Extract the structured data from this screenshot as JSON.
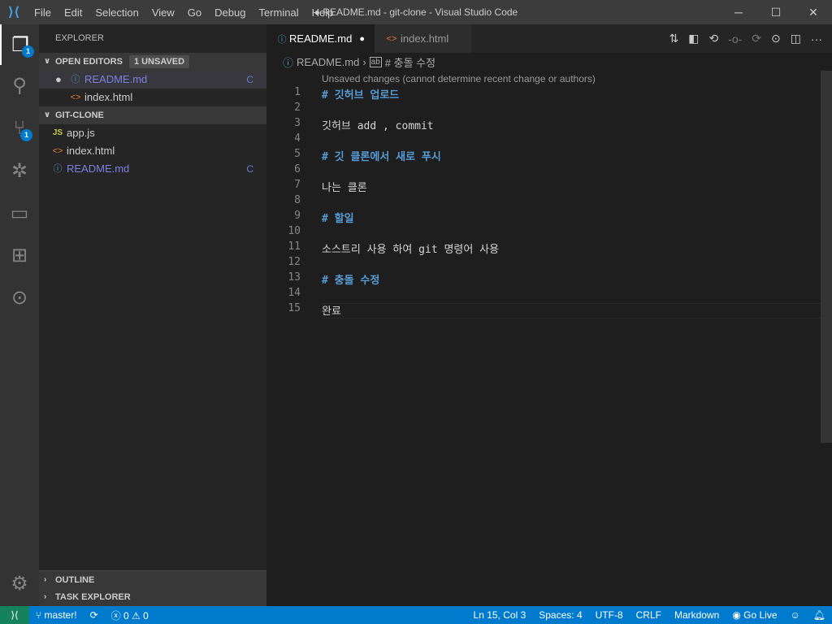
{
  "title": "● README.md - git-clone - Visual Studio Code",
  "menu": [
    "File",
    "Edit",
    "Selection",
    "View",
    "Go",
    "Debug",
    "Terminal",
    "Help"
  ],
  "activity": {
    "explorer_badge": "1",
    "scm_badge": "1"
  },
  "sidebar": {
    "title": "EXPLORER",
    "open_editors": {
      "label": "OPEN EDITORS",
      "badge": "1 UNSAVED",
      "items": [
        {
          "name": "README.md",
          "status": "C"
        },
        {
          "name": "index.html"
        }
      ]
    },
    "folder": {
      "label": "GIT-CLONE",
      "items": [
        {
          "name": "app.js"
        },
        {
          "name": "index.html"
        },
        {
          "name": "README.md",
          "status": "C"
        }
      ]
    },
    "outline": "OUTLINE",
    "task_explorer": "TASK EXPLORER"
  },
  "tabs": [
    {
      "label": "README.md",
      "dirty": true
    },
    {
      "label": "index.html"
    }
  ],
  "breadcrumb": {
    "file": "README.md",
    "symbol": "# 충돌 수정"
  },
  "codelens": "Unsaved changes (cannot determine recent change or authors)",
  "lines": [
    "# 깃허브 업로드",
    "",
    "깃허브 add , commit",
    "",
    "# 깃 클론에서 새로 푸시",
    "",
    "나는 클론",
    "",
    "# 할일",
    "",
    "소스트리 사용 하여 git 명령어 사용",
    "",
    "# 충돌 수정",
    "",
    "완료"
  ],
  "status": {
    "branch": "master!",
    "errors": "0",
    "warnings": "0",
    "position": "Ln 15, Col 3",
    "spaces": "Spaces: 4",
    "encoding": "UTF-8",
    "eol": "CRLF",
    "language": "Markdown",
    "golive": "Go Live"
  },
  "colors": {
    "accent": "#007acc",
    "remote": "#16825d",
    "heading": "#569cd6"
  }
}
